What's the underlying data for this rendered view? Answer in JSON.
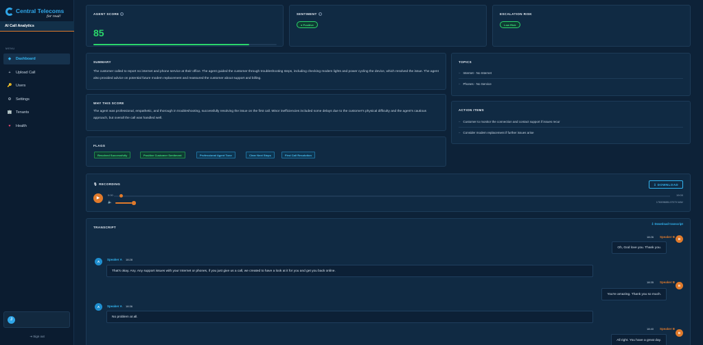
{
  "brand": {
    "name": "Central Telecoms",
    "tagline": "for real!"
  },
  "app": {
    "title": "AI Call Analytics"
  },
  "menu": {
    "label": "MENU",
    "items": [
      {
        "label": "Dashboard",
        "icon": "diamond-icon",
        "glyph": "◆",
        "active": true
      },
      {
        "label": "Upload Call",
        "icon": "plus-icon",
        "glyph": "+"
      },
      {
        "label": "Users",
        "icon": "key-icon",
        "glyph": "🔑"
      },
      {
        "label": "Settings",
        "icon": "gear-icon",
        "glyph": "⚙"
      },
      {
        "label": "Tenants",
        "icon": "building-icon",
        "glyph": "🏢"
      },
      {
        "label": "Health",
        "icon": "heart-icon",
        "glyph": "♥"
      }
    ]
  },
  "user": {
    "initial": "J"
  },
  "signout": {
    "label": "⇥ Sign out"
  },
  "agent_score": {
    "title": "AGENT SCORE",
    "value": "85",
    "fill_fraction": 0.85
  },
  "sentiment": {
    "title": "SENTIMENT",
    "badge": "● Positive"
  },
  "escalation": {
    "title": "ESCALATION RISK",
    "badge": "Low Risk"
  },
  "summary": {
    "title": "SUMMARY",
    "text": "The customer called to report no internet and phone service at their office. The agent guided the customer through troubleshooting steps, including checking modem lights and power cycling the device, which resolved the issue. The agent also provided advice on potential future modem replacement and reassured the customer about support and billing."
  },
  "why_score": {
    "title": "WHY THIS SCORE",
    "text": "The agent was professional, empathetic, and thorough in troubleshooting, successfully resolving the issue on the first call. Minor inefficiencies included some delays due to the customer's physical difficulty and the agent's cautious approach, but overall the call was handled well."
  },
  "flags": {
    "title": "FLAGS",
    "items": [
      {
        "label": "Resolved Successfully",
        "color": "green"
      },
      {
        "label": "Positive Customer Sentiment",
        "color": "green"
      },
      {
        "label": "Professional Agent Tone",
        "color": "blue"
      },
      {
        "label": "Clear Next Steps",
        "color": "blue"
      },
      {
        "label": "First Call Resolution",
        "color": "blue"
      }
    ]
  },
  "topics": {
    "title": "TOPICS",
    "items": [
      "Internet - No Internet",
      "Phones - No Service"
    ]
  },
  "action_items": {
    "title": "ACTION ITEMS",
    "items": [
      "Customer to monitor the connection and contact support if issues recur",
      "Consider modem replacement if further issues arise"
    ]
  },
  "recording": {
    "title": "RECORDING",
    "download_label": "⇩ DOWNLOAD",
    "current_time": "0:00",
    "duration": "19:00",
    "filename": "1760096881.5707X.WAV",
    "progress_fraction": 0.0,
    "volume_fraction": 0.8
  },
  "transcript": {
    "title": "TRANSCRIPT",
    "download_label": "⇩ Download transcript",
    "messages": [
      {
        "speaker": "Speaker B",
        "initial": "B",
        "time": "18:26",
        "text": "Oh, God love you. Thank you."
      },
      {
        "speaker": "Speaker A",
        "initial": "A",
        "time": "18:28",
        "text": "That's okay. Any. Any support issues with your Internet or phones, if you just give us a call, we created to have a look at it for you and get you back online."
      },
      {
        "speaker": "Speaker B",
        "initial": "B",
        "time": "18:35",
        "text": "You're amazing. Thank you so much."
      },
      {
        "speaker": "Speaker A",
        "initial": "A",
        "time": "18:36",
        "text": "No problem at all."
      },
      {
        "speaker": "Speaker B",
        "initial": "B",
        "time": "18:40",
        "text": "All right. You have a great day."
      }
    ]
  }
}
